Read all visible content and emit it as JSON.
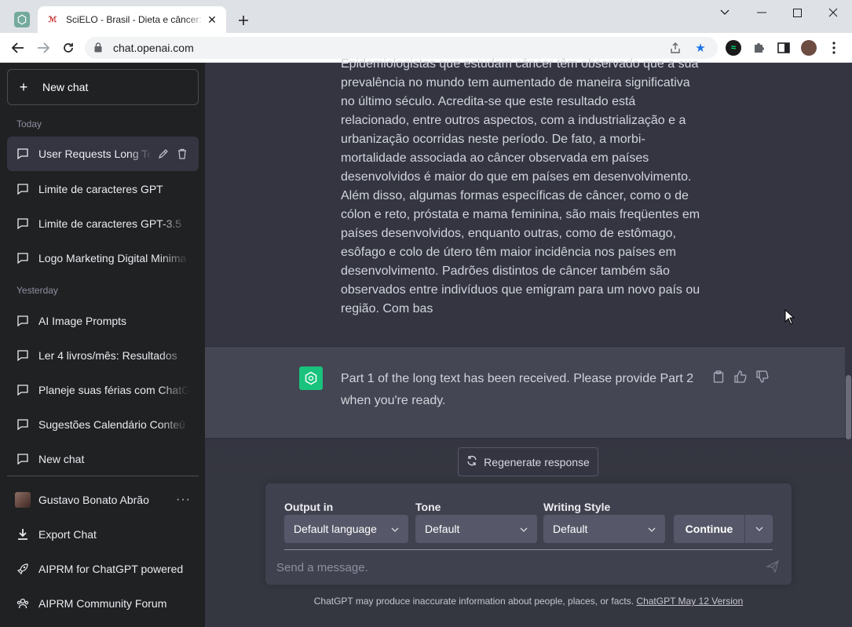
{
  "browser": {
    "tab_title": "SciELO - Brasil - Dieta e câncer: u",
    "url": "chat.openai.com",
    "scielo_favicon": "ℳ"
  },
  "sidebar": {
    "new_chat_label": "New chat",
    "today_label": "Today",
    "yesterday_label": "Yesterday",
    "today_items": [
      {
        "label": "User Requests Long Te"
      },
      {
        "label": "Limite de caracteres GPT"
      },
      {
        "label": "Limite de caracteres GPT-3.5"
      },
      {
        "label": "Logo Marketing Digital Minima"
      }
    ],
    "yesterday_items": [
      {
        "label": "AI Image Prompts"
      },
      {
        "label": "Ler 4 livros/mês: Resultados"
      },
      {
        "label": "Planeje suas férias com ChatG"
      },
      {
        "label": "Sugestões Calendário Conteú"
      },
      {
        "label": "New chat"
      }
    ],
    "user_name": "Gustavo Bonato Abrão",
    "more_label": "···",
    "export_label": "Export Chat",
    "aiprm_powered_label": "AIPRM for ChatGPT powered",
    "aiprm_forum_label": "AIPRM Community Forum"
  },
  "conversation": {
    "user_message": "Epidemiologistas que estudam câncer têm observado que a sua prevalência no mundo tem aumentado de maneira significativa no último século. Acredita-se que este resultado está relacionado, entre outros aspectos, com a industrialização e a urbanização ocorridas neste período. De fato, a morbi-mortalidade associada ao câncer observada em países desenvolvidos é maior do que em países em desenvolvimento. Além disso, algumas formas específicas de câncer, como o de cólon e reto, próstata e mama feminina, são mais freqüentes em países desenvolvidos, enquanto outras, como de estômago, esôfago e colo de útero têm maior incidência nos países em desenvolvimento. Padrões distintos de câncer também são observados entre indivíduos que emigram para um novo país ou região. Com bas",
    "assistant_message": "Part 1 of the long text has been received. Please provide Part 2 when you're ready."
  },
  "composer": {
    "regenerate_label": "Regenerate response",
    "output_label": "Output in",
    "output_value": "Default language",
    "tone_label": "Tone",
    "tone_value": "Default",
    "style_label": "Writing Style",
    "style_value": "Default",
    "continue_label": "Continue",
    "placeholder": "Send a message."
  },
  "footer": {
    "disclaimer": "ChatGPT may produce inaccurate information about people, places, or facts. ",
    "version_link": "ChatGPT May 12 Version"
  },
  "colors": {
    "sidebar_bg": "#202123",
    "main_bg": "#343541",
    "assistant_bg": "#444654",
    "gpt_green": "#19c37d",
    "bookmark_star": "#1a73e8"
  }
}
